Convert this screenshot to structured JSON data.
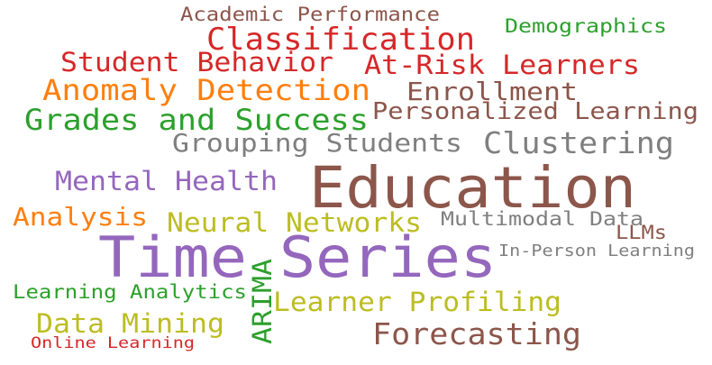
{
  "colors": {
    "brown": "#8c564b",
    "red": "#d62728",
    "green": "#2ca02c",
    "orange": "#ff7f0e",
    "gray": "#7f7f7f",
    "purple": "#9467bd",
    "olive": "#bcbd22"
  },
  "words": [
    {
      "text": "Academic Performance",
      "color": "#8c564b"
    },
    {
      "text": "Demographics",
      "color": "#2ca02c"
    },
    {
      "text": "Classification",
      "color": "#d62728"
    },
    {
      "text": "Student Behavior",
      "color": "#d62728"
    },
    {
      "text": "At-Risk Learners",
      "color": "#d62728"
    },
    {
      "text": "Anomaly Detection",
      "color": "#ff7f0e"
    },
    {
      "text": "Enrollment",
      "color": "#8c564b"
    },
    {
      "text": "Personalized Learning",
      "color": "#8c564b"
    },
    {
      "text": "Grades and Success",
      "color": "#2ca02c"
    },
    {
      "text": "Grouping Students",
      "color": "#7f7f7f"
    },
    {
      "text": "Clustering",
      "color": "#7f7f7f"
    },
    {
      "text": "Mental Health",
      "color": "#9467bd"
    },
    {
      "text": "Education",
      "color": "#8c564b"
    },
    {
      "text": "Analysis",
      "color": "#ff7f0e"
    },
    {
      "text": "Neural Networks",
      "color": "#bcbd22"
    },
    {
      "text": "Multimodal Data",
      "color": "#7f7f7f"
    },
    {
      "text": "LLMs",
      "color": "#8c564b"
    },
    {
      "text": "Time",
      "color": "#9467bd"
    },
    {
      "text": "Series",
      "color": "#9467bd"
    },
    {
      "text": "In-Person Learning",
      "color": "#7f7f7f"
    },
    {
      "text": "ARIMA",
      "color": "#2ca02c"
    },
    {
      "text": "Learning Analytics",
      "color": "#2ca02c"
    },
    {
      "text": "Learner Profiling",
      "color": "#bcbd22"
    },
    {
      "text": "Data Mining",
      "color": "#bcbd22"
    },
    {
      "text": "Forecasting",
      "color": "#8c564b"
    },
    {
      "text": "Online Learning",
      "color": "#d62728"
    }
  ]
}
